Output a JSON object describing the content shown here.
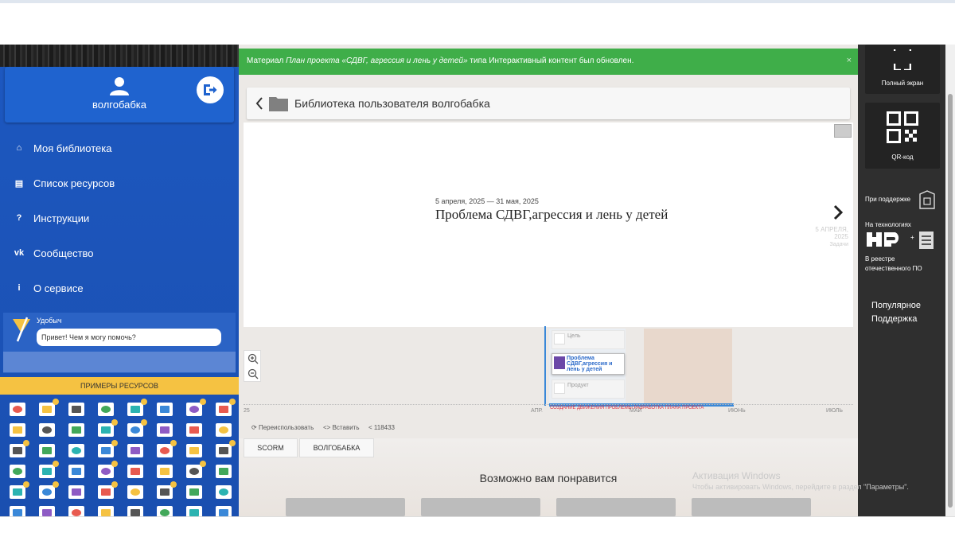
{
  "user": {
    "name": "волгобабка"
  },
  "nav": [
    {
      "label": "Моя библиотека"
    },
    {
      "label": "Список ресурсов"
    },
    {
      "label": "Инструкции"
    },
    {
      "label": "Сообщество"
    },
    {
      "label": "О сервисе"
    }
  ],
  "chat": {
    "name": "Удобыч",
    "message": "Привет! Чем я могу помочь?"
  },
  "examples": {
    "title": "ПРИМЕРЫ РЕСУРСОВ"
  },
  "notice": {
    "prefix": "Материал ",
    "title": "План проекта «СДВГ, агрессия и лень у детей»",
    "suffix": " типа Интерактивный контент был обновлен.",
    "close": "×"
  },
  "library": {
    "title": "Библиотека пользователя волгобабка"
  },
  "timeline": {
    "date_range": "5 апреля, 2025 — 31 мая, 2025",
    "title": "Проблема СДВГ,агрессия и лень у детей",
    "next_date": "5 АПРЕЛЯ, 2025",
    "next_tag": "Задачи",
    "slots": [
      {
        "label": "Цель"
      },
      {
        "label": "Проблема СДВГ,агрессия и лень у детей"
      },
      {
        "label": "Продукт"
      }
    ],
    "axis": [
      "25",
      "АПР.",
      "МАЙ",
      "ИЮНЬ",
      "ИЮЛЬ"
    ],
    "legend": "СОЗДАНИЕ ДВИЖЕНИЯ ПРОБЛЕМЫ РАЗРАБОТКА ПЛАНА ПРОЕКТА"
  },
  "actions": {
    "reuse": "Переиспользовать",
    "embed": "Вставить",
    "shares": "118433"
  },
  "tabs": [
    "SCORM",
    "ВОЛГОБАБКА"
  ],
  "may_like": "Возможно вам понравится",
  "right_panel": {
    "fullscreen": "Полный экран",
    "qr": "QR-код",
    "support": "При поддержке",
    "tech": "На технологиях",
    "registry": "В реестре отечественного ПО",
    "links": [
      "Популярное",
      "Поддержка"
    ]
  },
  "windows": {
    "title": "Активация Windows",
    "subtitle": "Чтобы активировать Windows, перейдите в раздел \"Параметры\"."
  },
  "colors": {
    "sidebar": "#1d58c0",
    "notice": "#3fae49",
    "accent_yellow": "#f5c242",
    "timeline_blue": "#3a88d8"
  }
}
